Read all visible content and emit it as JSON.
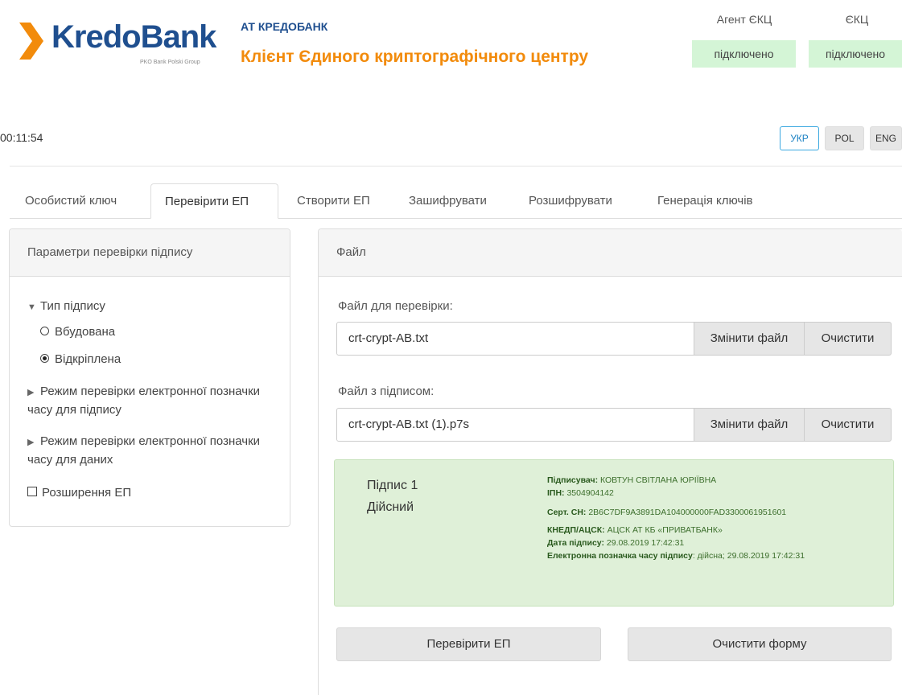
{
  "brand": {
    "logo_text": "KredoBank",
    "logo_subtitle": "PKO Bank Polski Group",
    "bank_name": "АТ КРЕДОБАНК",
    "app_title": "Клієнт Єдиного криптографічного центру",
    "accent_blue": "#1f4f8f",
    "accent_orange": "#f28b0c"
  },
  "status": {
    "agent_label": "Агент ЄКЦ",
    "agent_value": "підключено",
    "ekc_label": "ЄКЦ",
    "ekc_value": "підключено",
    "ok_color": "#d4f5d6"
  },
  "timer": "00:11:54",
  "languages": [
    {
      "label": "УКР",
      "active": true
    },
    {
      "label": "POL",
      "active": false
    },
    {
      "label": "ENG",
      "active": false
    }
  ],
  "tabs": [
    {
      "label": "Особистий ключ"
    },
    {
      "label": "Перевірити ЕП",
      "active": true
    },
    {
      "label": "Створити ЕП"
    },
    {
      "label": "Зашифрувати"
    },
    {
      "label": "Розшифрувати"
    },
    {
      "label": "Генерація ключів"
    }
  ],
  "left_panel": {
    "title": "Параметри перевірки підпису",
    "signature_type": "Тип підпису",
    "option_embedded": "Вбудована",
    "option_detached": "Відкріплена",
    "selected": "Відкріплена",
    "ts_signature": "Режим перевірки електронної позначки часу для підпису",
    "ts_data": "Режим перевірки електронної позначки часу для даних",
    "extensions": "Розширення ЕП"
  },
  "right_panel": {
    "title": "Файл",
    "file_label": "Файл для перевірки:",
    "file_value": "crt-crypt-AB.txt",
    "sig_label": "Файл з підписом:",
    "sig_value": "crt-crypt-AB.txt (1).p7s",
    "change_button": "Змінити файл",
    "clear_button": "Очистити"
  },
  "result": {
    "signature_number": "Підпис 1",
    "signature_status": "Дійсний",
    "signer_label": "Підписувач:",
    "signer_value": "КОВТУН СВІТЛАНА ЮРІЇВНА",
    "ipn_label": "ІПН:",
    "ipn_value": "3504904142",
    "cert_label": "Серт. СН:",
    "cert_value": "2B6C7DF9A3891DA104000000FAD3300061951601",
    "ca_label": "КНЕДП/АЦСК:",
    "ca_value": "АЦСК АТ КБ «ПРИВАТБАНК»",
    "date_label": "Дата підпису:",
    "date_value": "29.08.2019 17:42:31",
    "ts_label": "Електронна позначка часу підпису",
    "ts_value": ": дійсна; 29.08.2019 17:42:31"
  },
  "actions": {
    "verify_button": "Перевірити ЕП",
    "clear_form_button": "Очистити форму"
  }
}
